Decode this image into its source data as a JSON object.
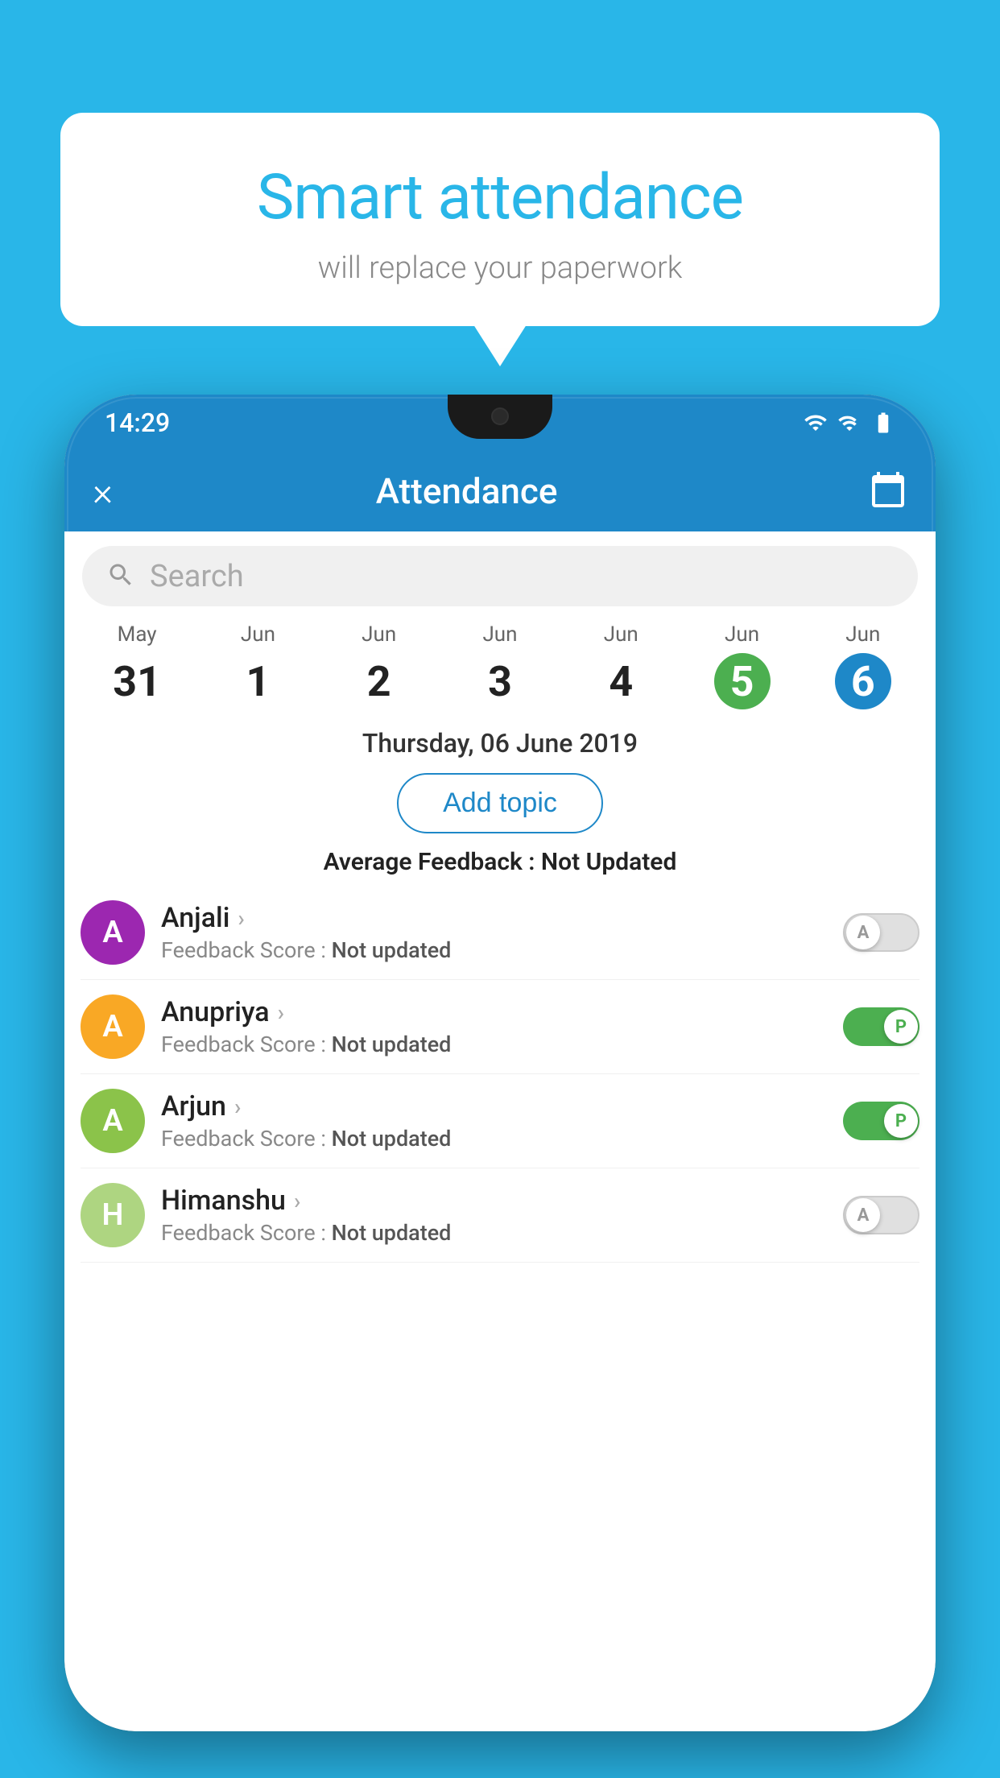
{
  "background_color": "#29b6e8",
  "bubble": {
    "title": "Smart attendance",
    "subtitle": "will replace your paperwork"
  },
  "status_bar": {
    "time": "14:29"
  },
  "app_bar": {
    "title": "Attendance",
    "close_label": "×"
  },
  "search": {
    "placeholder": "Search"
  },
  "calendar": {
    "days": [
      {
        "month": "May",
        "date": "31",
        "state": "normal"
      },
      {
        "month": "Jun",
        "date": "1",
        "state": "normal"
      },
      {
        "month": "Jun",
        "date": "2",
        "state": "normal"
      },
      {
        "month": "Jun",
        "date": "3",
        "state": "normal"
      },
      {
        "month": "Jun",
        "date": "4",
        "state": "normal"
      },
      {
        "month": "Jun",
        "date": "5",
        "state": "today"
      },
      {
        "month": "Jun",
        "date": "6",
        "state": "selected"
      }
    ],
    "selected_date_label": "Thursday, 06 June 2019"
  },
  "add_topic_btn": "Add topic",
  "avg_feedback": {
    "label": "Average Feedback : ",
    "value": "Not Updated"
  },
  "students": [
    {
      "name": "Anjali",
      "initial": "A",
      "color": "#9c27b0",
      "feedback_label": "Feedback Score : ",
      "feedback_value": "Not updated",
      "toggle": "off",
      "toggle_label": "A"
    },
    {
      "name": "Anupriya",
      "initial": "A",
      "color": "#f9a825",
      "feedback_label": "Feedback Score : ",
      "feedback_value": "Not updated",
      "toggle": "on",
      "toggle_label": "P"
    },
    {
      "name": "Arjun",
      "initial": "A",
      "color": "#8bc34a",
      "feedback_label": "Feedback Score : ",
      "feedback_value": "Not updated",
      "toggle": "on",
      "toggle_label": "P"
    },
    {
      "name": "Himanshu",
      "initial": "H",
      "color": "#aed581",
      "feedback_label": "Feedback Score : ",
      "feedback_value": "Not updated",
      "toggle": "off",
      "toggle_label": "A"
    }
  ]
}
